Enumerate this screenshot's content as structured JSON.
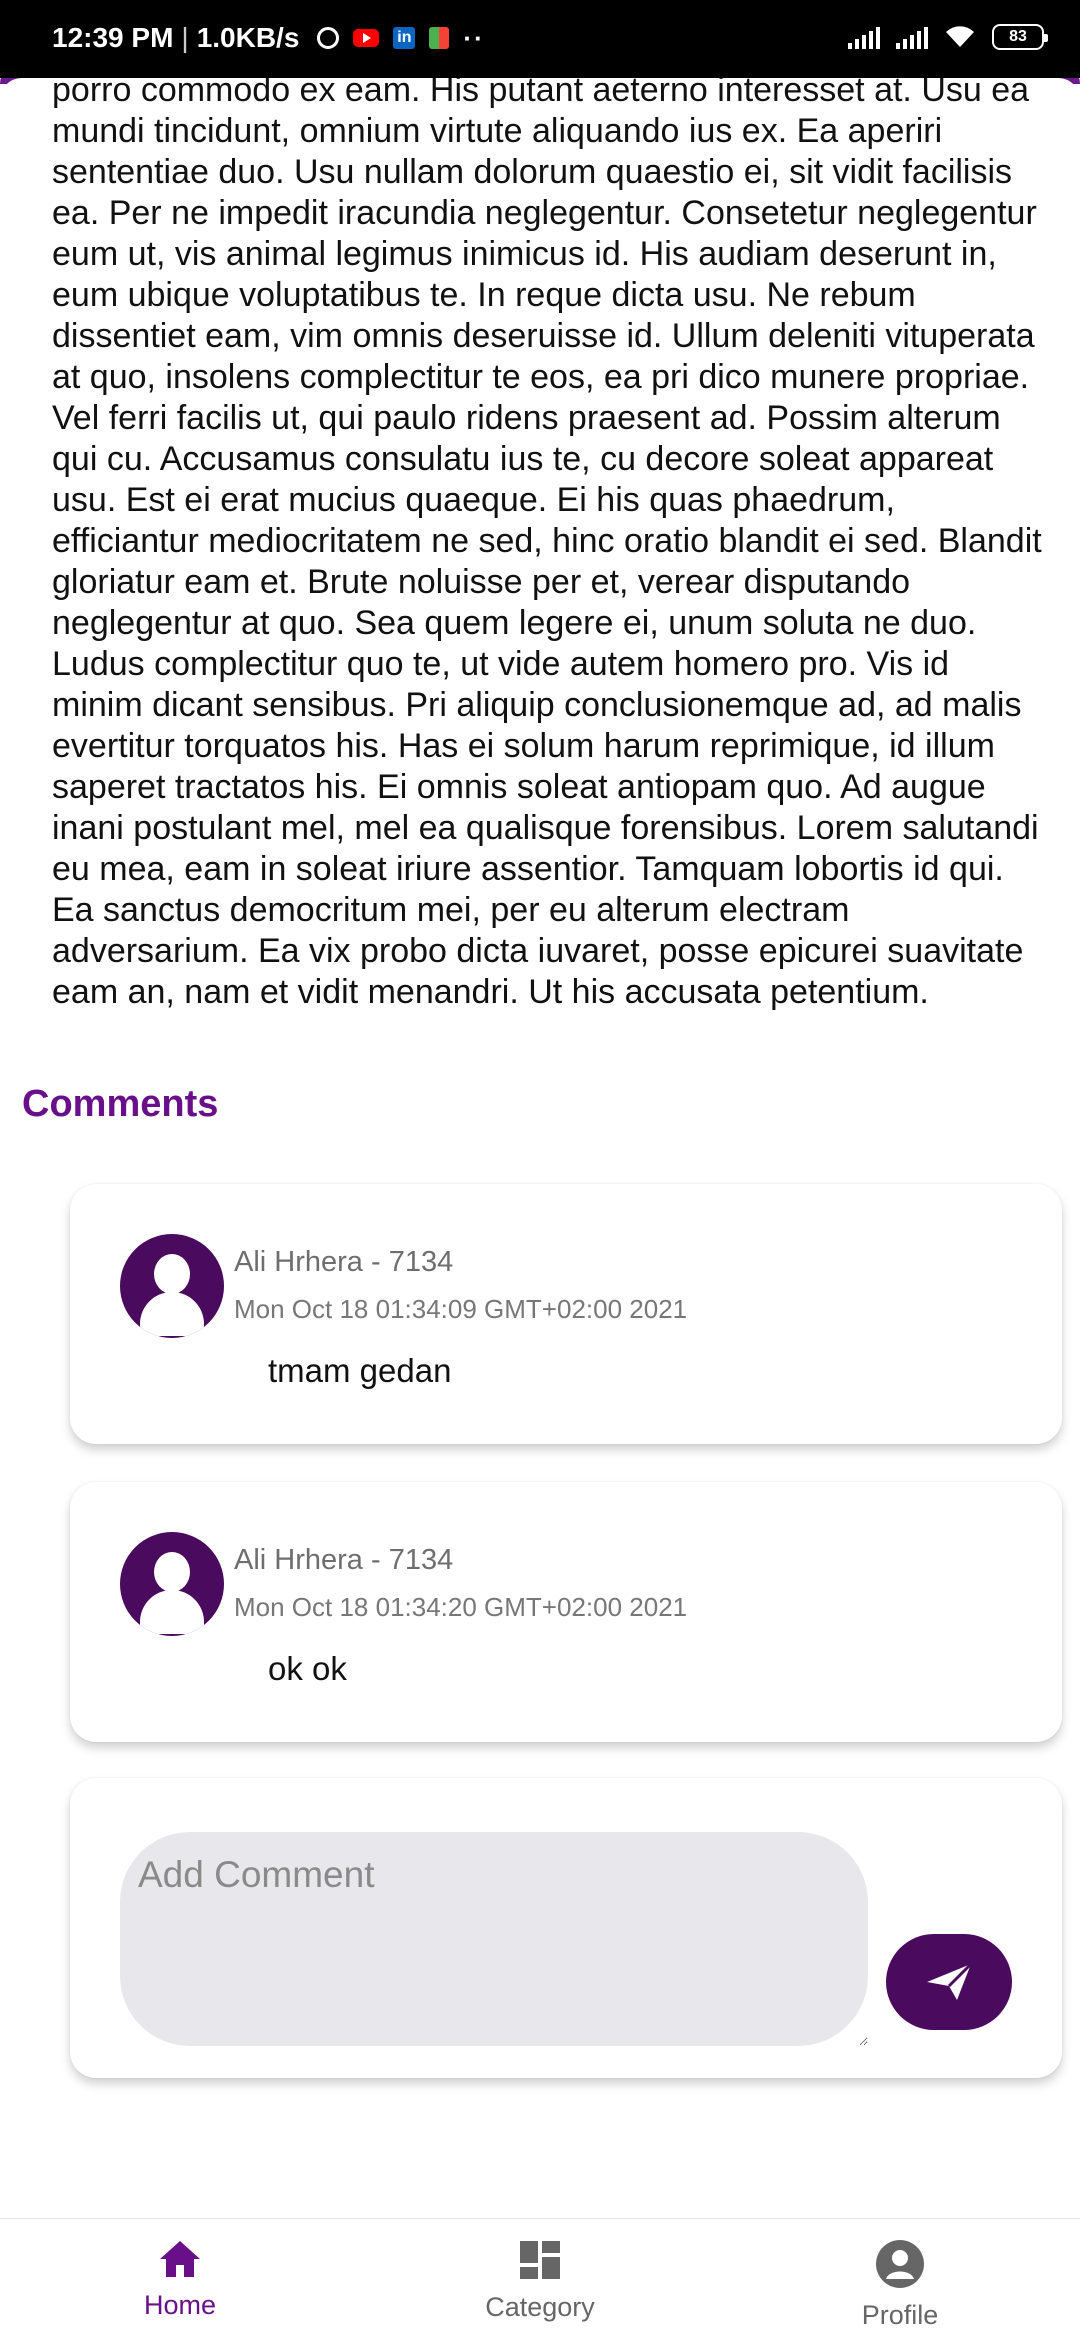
{
  "status_bar": {
    "time": "12:39 PM",
    "speed": "1.0KB/s",
    "battery": "83"
  },
  "article": {
    "text": "porro commodo ex eam. His putant aeterno interesset at. Usu ea mundi tincidunt, omnium virtute aliquando ius ex. Ea aperiri sententiae duo. Usu nullam dolorum quaestio ei, sit vidit facilisis ea. Per ne impedit iracundia neglegentur. Consetetur neglegentur eum ut, vis animal legimus inimicus id. His audiam deserunt in, eum ubique voluptatibus te. In reque dicta usu. Ne rebum dissentiet eam, vim omnis deseruisse id. Ullum deleniti vituperata at quo, insolens complectitur te eos, ea pri dico munere propriae. Vel ferri facilis ut, qui paulo ridens praesent ad. Possim alterum qui cu. Accusamus consulatu ius te, cu decore soleat appareat usu. Est ei erat mucius quaeque. Ei his quas phaedrum, efficiantur mediocritatem ne sed, hinc oratio blandit ei sed. Blandit gloriatur eam et. Brute noluisse per et, verear disputando neglegentur at quo. Sea quem legere ei, unum soluta ne duo. Ludus complectitur quo te, ut vide autem homero pro. Vis id minim dicant sensibus. Pri aliquip conclusionemque ad, ad malis evertitur torquatos his. Has ei solum harum reprimique, id illum saperet tractatos his. Ei omnis soleat antiopam quo. Ad augue inani postulant mel, mel ea qualisque forensibus. Lorem salutandi eu mea, eam in soleat iriure assentior. Tamquam lobortis id qui. Ea sanctus democritum mei, per eu alterum electram adversarium. Ea vix probo dicta iuvaret, posse epicurei suavitate eam an, nam et vidit menandri. Ut his accusata petentium."
  },
  "comments": {
    "title": "Comments",
    "items": [
      {
        "author": "Ali Hrhera - 7134",
        "date": "Mon Oct 18 01:34:09 GMT+02:00 2021",
        "text": "tmam gedan"
      },
      {
        "author": "Ali Hrhera - 7134",
        "date": "Mon Oct 18 01:34:20 GMT+02:00 2021",
        "text": "ok ok"
      }
    ],
    "input_placeholder": "Add Comment",
    "input_value": ""
  },
  "bottom_nav": {
    "items": [
      {
        "label": "Home",
        "icon": "home-icon",
        "active": true
      },
      {
        "label": "Category",
        "icon": "dashboard-icon",
        "active": false
      },
      {
        "label": "Profile",
        "icon": "account-circle-icon",
        "active": false
      }
    ]
  },
  "colors": {
    "accent": "#6a0f8a",
    "avatar_bg": "#4a0a5e",
    "input_bg": "#e8e7eb"
  }
}
